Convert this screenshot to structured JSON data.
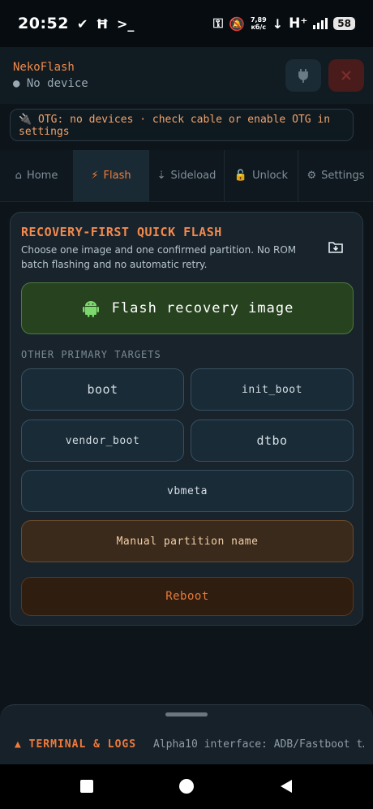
{
  "status_bar": {
    "time": "20:52",
    "left_icons": [
      "check-icon",
      "h-icon",
      "terminal-prompt-icon"
    ],
    "net_speed_value": "7,89",
    "net_speed_unit": "кб/с",
    "network_type": "H⁺",
    "battery": "58"
  },
  "header": {
    "app_title": "NekoFlash",
    "device_status": "● No device",
    "plug_icon": "plug-icon",
    "close_icon": "close-icon"
  },
  "otg": {
    "message": "🔌 OTG: no devices · check cable or enable OTG in settings"
  },
  "tabs": [
    {
      "icon": "⌂",
      "label": "Home"
    },
    {
      "icon": "⚡",
      "label": "Flash"
    },
    {
      "icon": "⇣",
      "label": "Sideload"
    },
    {
      "icon": "🔓",
      "label": "Unlock"
    },
    {
      "icon": "⚙",
      "label": "Settings"
    }
  ],
  "active_tab": "Flash",
  "card": {
    "title": "RECOVERY-FIRST QUICK FLASH",
    "description": "Choose one image and one confirmed partition. No ROM batch flashing and no automatic retry.",
    "flash_recovery_label": "Flash recovery image",
    "section_label": "OTHER PRIMARY TARGETS",
    "targets": [
      "boot",
      "init_boot",
      "vendor_boot",
      "dtbo",
      "vbmeta"
    ],
    "manual_label": "Manual partition name",
    "reboot_label": "Reboot"
  },
  "terminal": {
    "title": "▲ TERMINAL & LOGS",
    "preview": "Alpha10 interface: ADB/Fastboot t…"
  },
  "colors": {
    "accent": "#f08a4b",
    "flash_button_bg": "#27421f",
    "manual_button_bg": "#3a2a1b",
    "reboot_button_bg": "#2f1d10"
  }
}
